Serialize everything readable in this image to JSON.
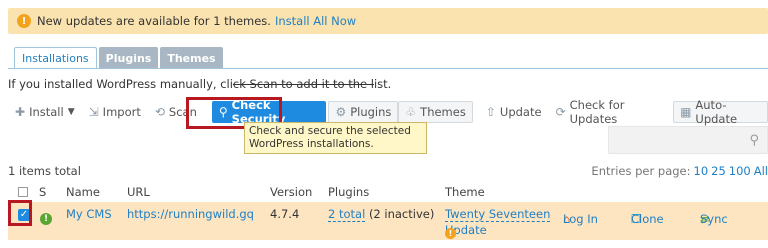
{
  "notice": {
    "icon": "warning-icon",
    "message": "New updates are available for 1 themes.",
    "link": "Install All Now"
  },
  "tabs": [
    "Installations",
    "Plugins",
    "Themes"
  ],
  "manual": {
    "prefix": "If you installed WordPress manually, cli",
    "struck": "ck Scan to add it to the l",
    "suffix": "ist."
  },
  "toolbar": {
    "install": "Install",
    "import": "Import",
    "scan": "Scan",
    "check_security": "Check Security",
    "plugins": "Plugins",
    "themes": "Themes",
    "update": "Update",
    "check_updates": "Check for Updates",
    "auto_update": "Auto-Update"
  },
  "tooltip": "Check and secure the selected WordPress installations.",
  "list": {
    "total": "1 items total",
    "per_page_label": "Entries per page:",
    "per_page_options": [
      "10",
      "25",
      "100",
      "All"
    ]
  },
  "columns": {
    "s": "S",
    "name": "Name",
    "url": "URL",
    "version": "Version",
    "plugins": "Plugins",
    "theme": "Theme"
  },
  "row": {
    "name": "My CMS",
    "url": "https://runningwild.gq",
    "version": "4.7.4",
    "plugins_link": "2 total",
    "plugins_note": "(2 inactive)",
    "theme": "Twenty Seventeen",
    "theme_update": "Update",
    "login": "Log In",
    "clone": "Clone",
    "sync": "Sync"
  },
  "colors": {
    "accent": "#1f8be0",
    "notice_bg": "#fbe3b0",
    "row_bg": "#fde5c2",
    "highlight": "#b8181f"
  }
}
